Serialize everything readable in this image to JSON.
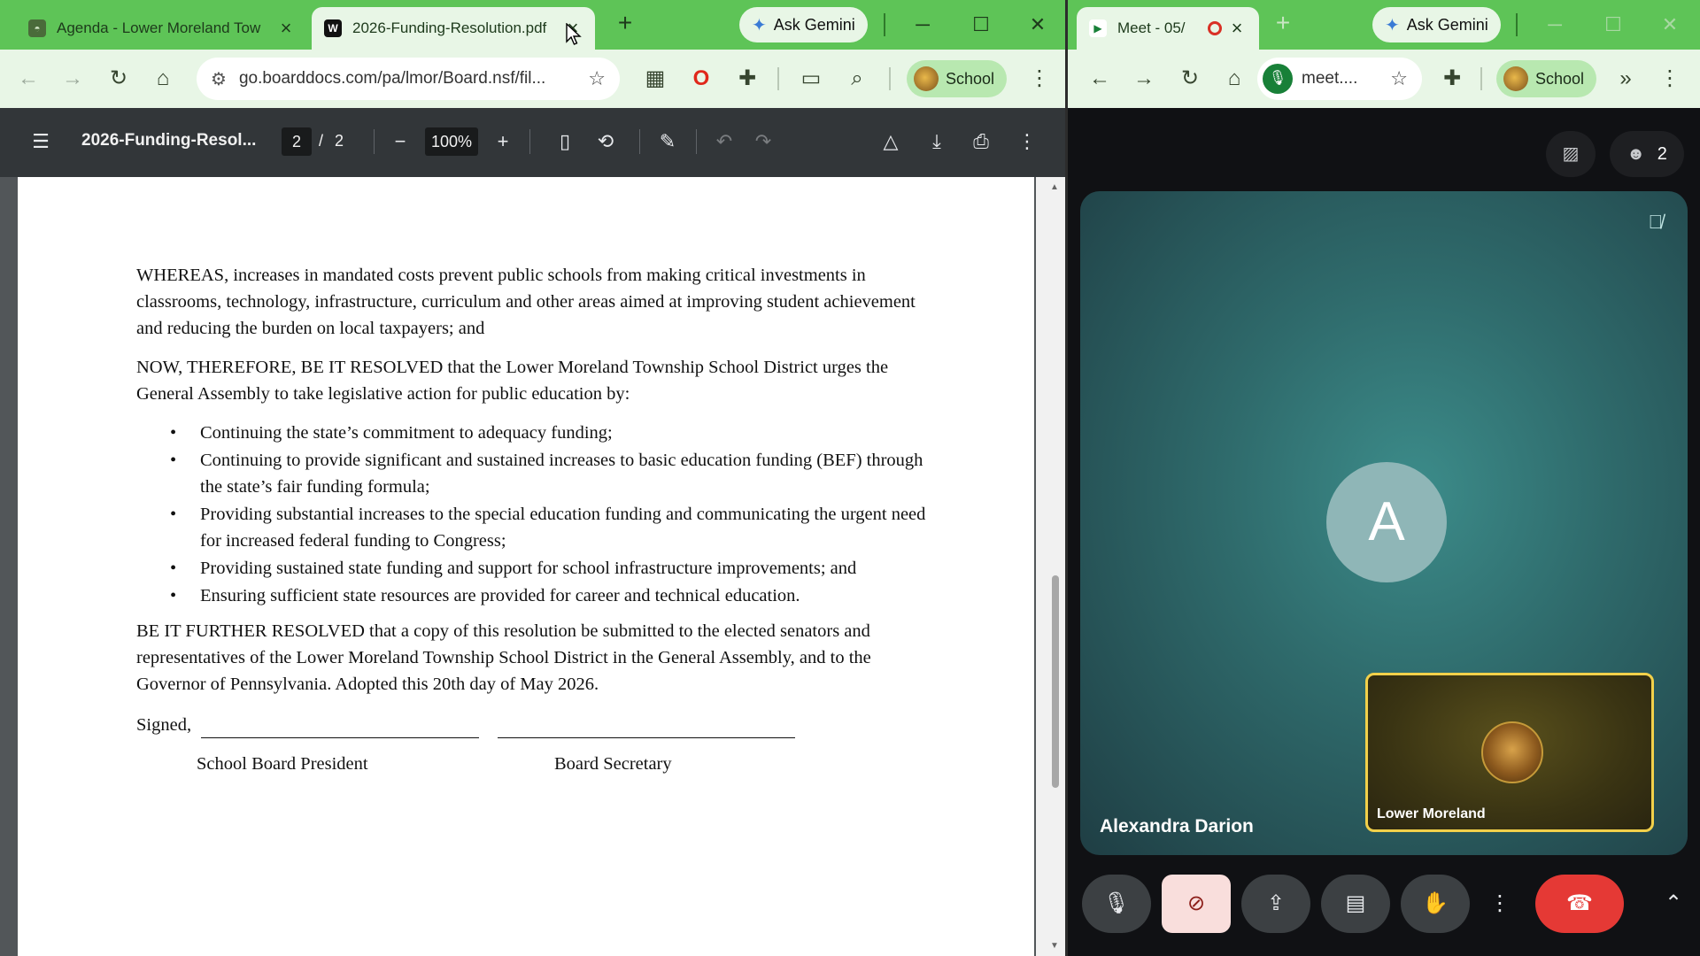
{
  "left_browser": {
    "tabs": [
      {
        "title": "Agenda - Lower Moreland Tow",
        "active": false
      },
      {
        "title": "2026-Funding-Resolution.pdf",
        "active": true
      }
    ],
    "ask_gemini": "Ask Gemini",
    "address": "go.boarddocs.com/pa/lmor/Board.nsf/fil...",
    "profile": "School"
  },
  "pdf": {
    "title": "2026-Funding-Resol...",
    "page_current": "2",
    "page_separator": "/",
    "page_total": "2",
    "zoom": "100%",
    "paragraphs": {
      "whereas": "WHEREAS, increases in mandated costs prevent public schools from making critical investments in classrooms, technology, infrastructure, curriculum and other areas aimed at improving student achievement and reducing the burden on local taxpayers; and",
      "resolved": "NOW, THEREFORE, BE IT RESOLVED that the Lower Moreland Township School District urges the General Assembly to take legislative action for public education by:",
      "bullets": [
        "Continuing the state’s commitment to adequacy funding;",
        "Continuing to provide significant and sustained increases to basic education funding (BEF) through the state’s fair funding formula;",
        "Providing substantial increases to the special education funding and communicating the urgent need for increased federal funding to Congress;",
        "Providing sustained state funding and support for school infrastructure improvements; and",
        "Ensuring sufficient state resources are provided for career and technical education."
      ],
      "further": "BE IT FURTHER RESOLVED that a copy of this resolution be submitted to the elected senators and representatives of the Lower Moreland Township School District in the General Assembly, and to the Governor of Pennsylvania. Adopted this 20th day of May 2026.",
      "signed": "Signed,",
      "role_president": "School Board President",
      "role_secretary": "Board Secretary"
    }
  },
  "right_browser": {
    "tab_title": "Meet - 05/",
    "ask_gemini": "Ask Gemini",
    "address": "meet....",
    "profile": "School"
  },
  "meet": {
    "participant_count": "2",
    "main_participant_initial": "A",
    "main_participant_name": "Alexandra Darion",
    "self_name": "Lower Moreland"
  }
}
